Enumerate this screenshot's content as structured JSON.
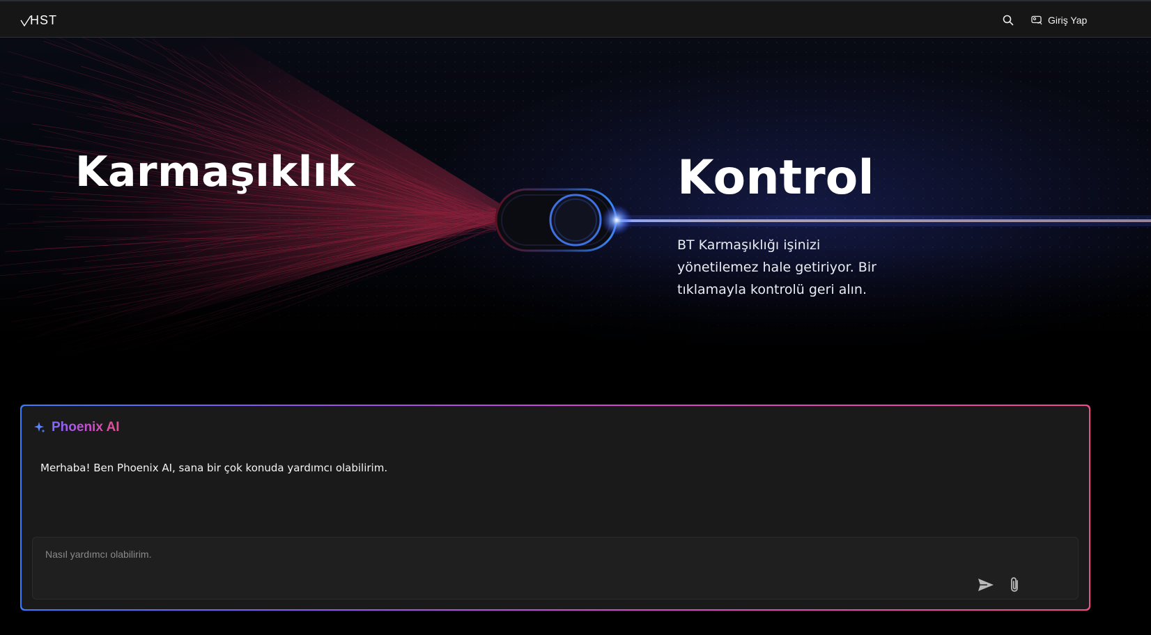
{
  "header": {
    "logo_text": "HST",
    "login_label": "Giriş Yap",
    "icons": {
      "search": "search-icon",
      "login": "user-card-icon",
      "logo": "vhst-logo"
    }
  },
  "hero": {
    "title_left": "Karmaşıklık",
    "title_right": "Kontrol",
    "description": "BT Karmaşıklığı işinizi yönetilemez hale getiriyor. Bir tıklamayla kontrolü geri alın."
  },
  "chat": {
    "title": "Phoenix AI",
    "title_icon": "sparkle-icon",
    "message": "Merhaba! Ben Phoenix AI, sana bir çok konuda yardımcı olabilirim.",
    "input_placeholder": "Nasıl yardımcı olabilirim.",
    "input_value": "",
    "send_icon": "send-icon",
    "attach_icon": "paperclip-icon"
  },
  "colors": {
    "background": "#000000",
    "topbar": "#161616",
    "chat_panel": "#1a1a1a",
    "gradient_start": "#3b7dff",
    "gradient_mid": "#d24ad0",
    "gradient_end": "#ef4d8d",
    "fiber_red": "#8a1f3c",
    "beam_blue": "#3f6dff"
  }
}
